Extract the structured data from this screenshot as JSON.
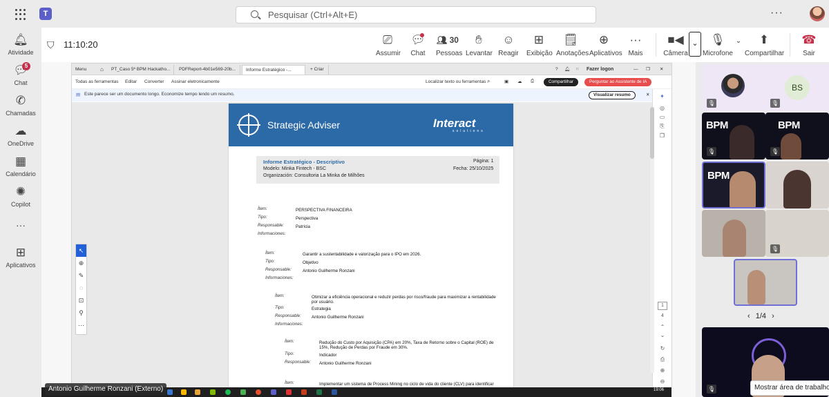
{
  "topbar": {
    "search_placeholder": "Pesquisar (Ctrl+Alt+E)"
  },
  "rail": [
    {
      "label": "Atividade",
      "icon": "bell-icon"
    },
    {
      "label": "Chat",
      "icon": "chat-icon",
      "badge": "5"
    },
    {
      "label": "Chamadas",
      "icon": "phone-icon"
    },
    {
      "label": "OneDrive",
      "icon": "cloud-icon"
    },
    {
      "label": "Calendário",
      "icon": "calendar-icon"
    },
    {
      "label": "Copilot",
      "icon": "copilot-icon"
    },
    {
      "label": "Aplicativos",
      "icon": "apps-plus-icon"
    }
  ],
  "meeting": {
    "timer": "11:10:20",
    "buttons": [
      {
        "label": "Assumir"
      },
      {
        "label": "Chat"
      },
      {
        "label": "Pessoas",
        "count": "30"
      },
      {
        "label": "Levantar"
      },
      {
        "label": "Reagir"
      },
      {
        "label": "Exibição"
      },
      {
        "label": "Anotações"
      },
      {
        "label": "Aplicativos"
      },
      {
        "label": "Mais"
      },
      {
        "label": "Câmera"
      },
      {
        "label": "Microfone"
      },
      {
        "label": "Compartilhar"
      },
      {
        "label": "Sair"
      }
    ]
  },
  "viewer": {
    "tabs": [
      "Menu",
      "PT_Caso 5ª BPM Hackatho...",
      "PDFReport-4b01e569-20b...",
      "Informe Estratégico -...",
      "+ Criar"
    ],
    "login": "Fazer logon",
    "toolbar": [
      "Todas as ferramentas",
      "Editar",
      "Converter",
      "Assinar eletronicamente"
    ],
    "find": "Localizar texto ou ferramentas",
    "share_btn": "Compartilhar",
    "ai_btn": "Perguntar ao Assistente de IA",
    "banner": "Este parece ser um documento longo. Economize tempo lendo um resumo.",
    "summary_btn": "Visualizar resumo",
    "page_num": "1",
    "page_total": "4"
  },
  "doc": {
    "brand": "Strategic Adviser",
    "logo": "Interact",
    "logo_sub": "solutions",
    "title": "Informe Estratégico - Descriptivo",
    "modelo": "Modelo: Minka Fintech - BSC",
    "org": "Organización: Consultoria La Minka de Milhões",
    "pagina": "Página: 1",
    "fecha": "Fecha: 25/10/2025",
    "entries": [
      {
        "item": "PERSPECTIVA FINANCEIRA",
        "tipo": "Perspectiva",
        "resp": "Patrícia",
        "info": ""
      },
      {
        "item": "Garantir a sustentabilidade e valorização para o IPO em 2026.",
        "tipo": "Objetivo",
        "resp": "Antonio Guilherme Ronzani",
        "info": ""
      },
      {
        "item": "Otimizar a eficiência operacional e reduzir perdas por risco/fraude para maximizar a rentabilidade",
        "item2": "por usuário.",
        "tipo": "Estrategia",
        "resp": "Antonio Guilherme Ronzani",
        "info": ""
      },
      {
        "item": "Redução do Custo por Aquisição (CPA) em 20%, Taxa de Retorno sobre o Capital (ROE) de",
        "item2": "15%, Redução de Perdas por Fraude em 30%.",
        "tipo": "Indicador",
        "resp": "Antonio Guilherme Ronzani"
      },
      {
        "item": "Implementar um sistema de Process Mining no ciclo de vida do cliente (CLV) para identificar"
      }
    ],
    "labels": {
      "item": "Ítem:",
      "tipo": "Tipo:",
      "resp": "Responsable:",
      "info": "Informaciones:"
    }
  },
  "presenter": "Antonio Guilherme Ronzani (Externo)",
  "participants": {
    "initials": "BS",
    "bpm_text": "BPM",
    "pager": "1/4"
  },
  "share_tip": "Mostrar área de trabalho",
  "clock": "19:06"
}
